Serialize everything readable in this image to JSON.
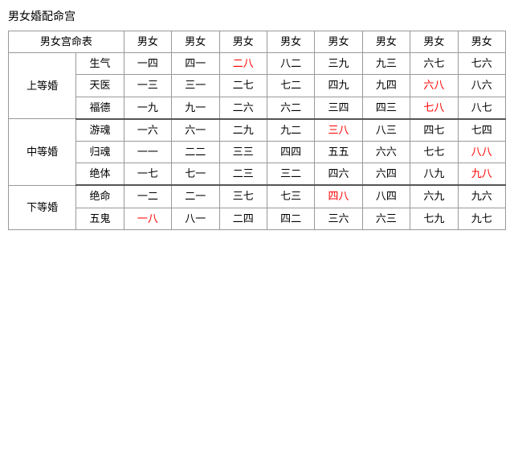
{
  "title": "男女婚配命宫",
  "table": {
    "header": {
      "col0": "男女宫命表",
      "cols": [
        "男女",
        "男女",
        "男女",
        "男女",
        "男女",
        "男女",
        "男女",
        "男女"
      ]
    },
    "rows": [
      {
        "group": "上等婚",
        "subrows": [
          {
            "sub": "生气",
            "cells": [
              {
                "text": "一四",
                "red": false
              },
              {
                "text": "四一",
                "red": false
              },
              {
                "text": "二八",
                "red": true
              },
              {
                "text": "八二",
                "red": false
              },
              {
                "text": "三九",
                "red": false
              },
              {
                "text": "九三",
                "red": false
              },
              {
                "text": "六七",
                "red": false
              },
              {
                "text": "七六",
                "red": false
              }
            ]
          },
          {
            "sub": "天医",
            "cells": [
              {
                "text": "一三",
                "red": false
              },
              {
                "text": "三一",
                "red": false
              },
              {
                "text": "二七",
                "red": false
              },
              {
                "text": "七二",
                "red": false
              },
              {
                "text": "四九",
                "red": false
              },
              {
                "text": "九四",
                "red": false
              },
              {
                "text": "六八",
                "red": true
              },
              {
                "text": "八六",
                "red": false
              }
            ]
          },
          {
            "sub": "福德",
            "cells": [
              {
                "text": "一九",
                "red": false
              },
              {
                "text": "九一",
                "red": false
              },
              {
                "text": "二六",
                "red": false
              },
              {
                "text": "六二",
                "red": false
              },
              {
                "text": "三四",
                "red": false
              },
              {
                "text": "四三",
                "red": false
              },
              {
                "text": "七八",
                "red": true
              },
              {
                "text": "八七",
                "red": false
              }
            ]
          }
        ]
      },
      {
        "group": "中等婚",
        "subrows": [
          {
            "sub": "游魂",
            "cells": [
              {
                "text": "一六",
                "red": false
              },
              {
                "text": "六一",
                "red": false
              },
              {
                "text": "二九",
                "red": false
              },
              {
                "text": "九二",
                "red": false
              },
              {
                "text": "三八",
                "red": true
              },
              {
                "text": "八三",
                "red": false
              },
              {
                "text": "四七",
                "red": false
              },
              {
                "text": "七四",
                "red": false
              }
            ]
          },
          {
            "sub": "归魂",
            "cells": [
              {
                "text": "一一",
                "red": false
              },
              {
                "text": "二二",
                "red": false
              },
              {
                "text": "三三",
                "red": false
              },
              {
                "text": "四四",
                "red": false
              },
              {
                "text": "五五",
                "red": false
              },
              {
                "text": "六六",
                "red": false
              },
              {
                "text": "七七",
                "red": false
              },
              {
                "text": "八八",
                "red": true
              }
            ]
          },
          {
            "sub": "绝体",
            "cells": [
              {
                "text": "一七",
                "red": false
              },
              {
                "text": "七一",
                "red": false
              },
              {
                "text": "二三",
                "red": false
              },
              {
                "text": "三二",
                "red": false
              },
              {
                "text": "四六",
                "red": false
              },
              {
                "text": "六四",
                "red": false
              },
              {
                "text": "八九",
                "red": false
              },
              {
                "text": "九八",
                "red": true
              }
            ]
          }
        ]
      },
      {
        "group": "下等婚",
        "subrows": [
          {
            "sub": "绝命",
            "cells": [
              {
                "text": "一二",
                "red": false
              },
              {
                "text": "二一",
                "red": false
              },
              {
                "text": "三七",
                "red": false
              },
              {
                "text": "七三",
                "red": false
              },
              {
                "text": "四八",
                "red": true
              },
              {
                "text": "八四",
                "red": false
              },
              {
                "text": "六九",
                "red": false
              },
              {
                "text": "九六",
                "red": false
              }
            ]
          },
          {
            "sub": "五鬼",
            "cells": [
              {
                "text": "一八",
                "red": true
              },
              {
                "text": "八一",
                "red": false
              },
              {
                "text": "二四",
                "red": false
              },
              {
                "text": "四二",
                "red": false
              },
              {
                "text": "三六",
                "red": false
              },
              {
                "text": "六三",
                "red": false
              },
              {
                "text": "七九",
                "red": false
              },
              {
                "text": "九七",
                "red": false
              }
            ]
          }
        ]
      }
    ]
  }
}
